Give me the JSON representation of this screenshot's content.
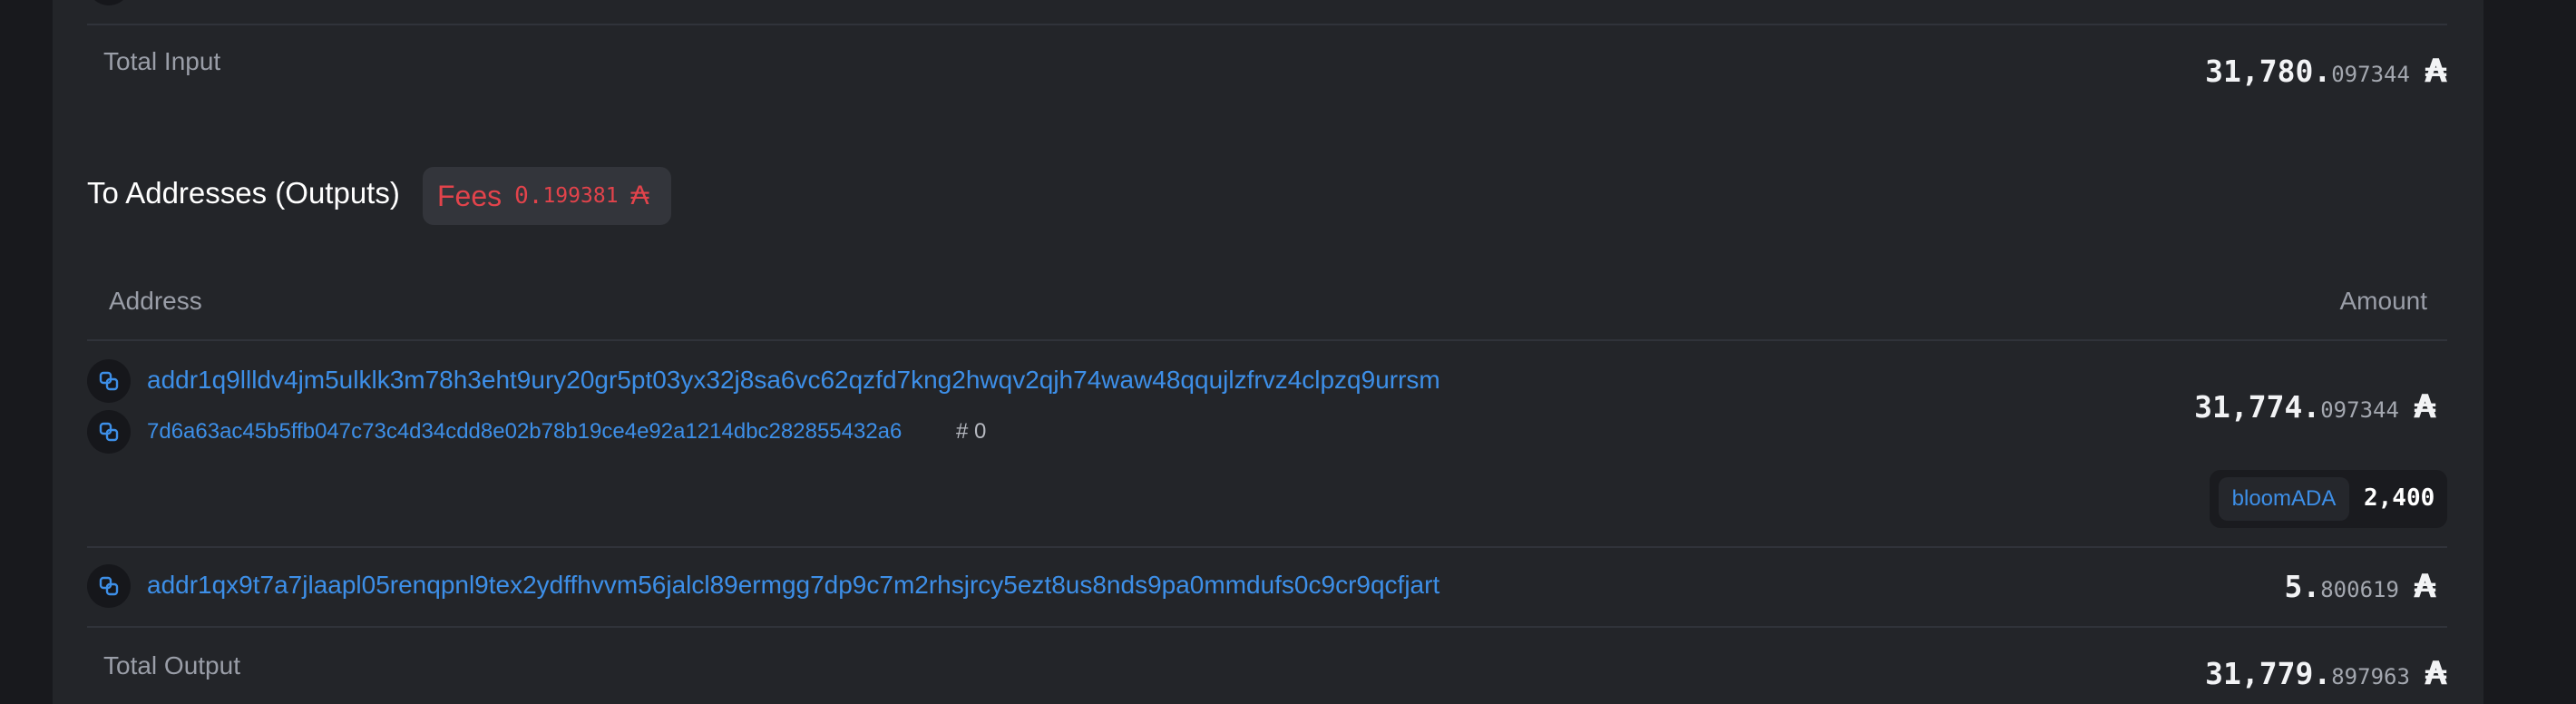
{
  "inputs": {
    "total_label": "Total Input",
    "total_int": "31,780.",
    "total_frac": "097344",
    "currency": "₳"
  },
  "outputs": {
    "title": "To Addresses (Outputs)",
    "fees_label": "Fees",
    "fees_int": "0.",
    "fees_frac": "199381",
    "fees_currency": "₳",
    "col_address": "Address",
    "col_amount": "Amount",
    "rows": [
      {
        "address": "addr1q9llldv4jm5ulklk3m78h3eht9ury20gr5pt03yx32j8sa6vc62qzfd7kng2hwqv2qjh74waw48qqujlzfrvz4clpzq9urrsm",
        "tx_hash": "7d6a63ac45b5ffb047c73c4d34cdd8e02b78b19ce4e92a1214dbc282855432a6",
        "tx_index": "# 0",
        "amount_int": "31,774.",
        "amount_frac": "097344",
        "currency": "₳",
        "token_name": "bloomADA",
        "token_amount": "2,400"
      },
      {
        "address": "addr1qx9t7a7jlaapl05renqpnl9tex2ydffhvvm56jalcl89ermgg7dp9c7m2rhsjrcy5ezt8us8nds9pa0mmdufs0c9cr9qcfjart",
        "amount_int": "5.",
        "amount_frac": "800619",
        "currency": "₳"
      }
    ],
    "total_label": "Total Output",
    "total_int": "31,779.",
    "total_frac": "897963",
    "currency": "₳"
  },
  "icons": {
    "copy": "copy-icon"
  },
  "colors": {
    "link": "#3d8fe8",
    "fees": "#e2434b",
    "panel": "#232529",
    "background": "#18191d"
  }
}
